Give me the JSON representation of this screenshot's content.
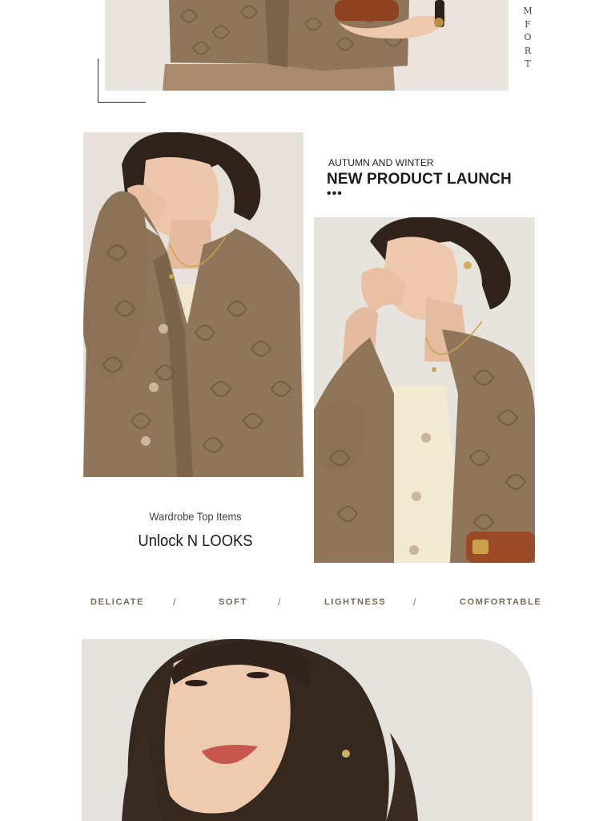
{
  "top_section": {
    "side_word": "MFORT",
    "photo_alt": "Model in brown lace-knit cardigan holding a leather bag"
  },
  "launch": {
    "subtitle": "AUTUMN AND WINTER",
    "title": "NEW PRODUCT LAUNCH",
    "dots": "•••"
  },
  "taglines": {
    "wardrobe": "Wardrobe Top Items",
    "unlock": "Unlock N LOOKS"
  },
  "features": [
    "DELICATE",
    "SOFT",
    "LIGHTNESS",
    "COMFORTABLE"
  ],
  "separator": "/",
  "colors": {
    "cardigan": "#8f7559",
    "cardigan_dark": "#6e5841",
    "background_photo": "#e8e3dc",
    "hair": "#2f231b",
    "skin": "#e9c3a9",
    "feature_text": "#7a6a58",
    "bag": "#9a4a26"
  }
}
